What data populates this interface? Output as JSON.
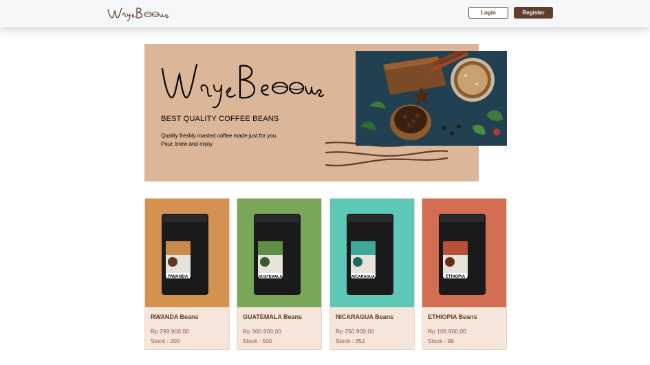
{
  "brand": {
    "name": "WaysBeans",
    "accent": "#613d2b",
    "hero_bg": "#dbb699",
    "card_bg": "#f6e6da",
    "price_color": "#974a4a"
  },
  "navbar": {
    "login_label": "Login",
    "register_label": "Register"
  },
  "hero": {
    "subtitle": "BEST QUALITY COFFEE BEANS",
    "description_line1": "Quality freshly roasted coffee made just for you.",
    "description_line2": "Pour, brew and enjoy",
    "image_icon": "coffee-photo"
  },
  "products": [
    {
      "name": "RWANDA Beans",
      "price": "Rp 299.900,00",
      "stock": "Stock : 200",
      "bg_color": "#d3924f",
      "bag_label": "RWANDA"
    },
    {
      "name": "GUATEMALA Beans",
      "price": "Rp 300.900,00",
      "stock": "Stock : 500",
      "bg_color": "#7aa65a",
      "bag_label": "GUATEMALA"
    },
    {
      "name": "NICARAGUA Beans",
      "price": "Rp 250.900,00",
      "stock": "Stock : 352",
      "bg_color": "#5dc8b6",
      "bag_label": "NICARAGUA"
    },
    {
      "name": "ETHIOPIA Beans",
      "price": "Rp 109.900,00",
      "stock": "Stock : 99",
      "bg_color": "#d46e52",
      "bag_label": "ETHIOPIA"
    }
  ]
}
